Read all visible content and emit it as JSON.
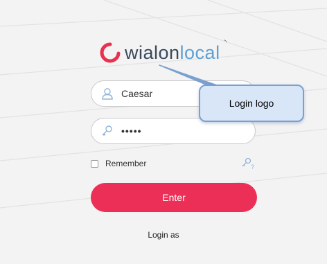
{
  "logo": {
    "brand_main": "wialon",
    "brand_accent": "local",
    "colors": {
      "mark": "#e8314f",
      "main": "#3a4a5c",
      "accent": "#5fa0d4"
    }
  },
  "form": {
    "username": {
      "value": "Caesar",
      "icon": "user-icon"
    },
    "password": {
      "value": "•••••",
      "icon": "key-icon"
    },
    "remember_label": "Remember",
    "remember_checked": false,
    "reset_icon": "key-user-icon",
    "enter_label": "Enter",
    "login_as_label": "Login as"
  },
  "callout": {
    "text": "Login logo"
  },
  "colors": {
    "accent": "#ec2f57",
    "background": "#f3f3f3"
  }
}
